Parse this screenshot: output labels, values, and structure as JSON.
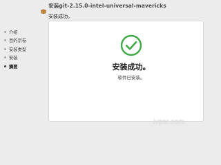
{
  "window": {
    "title": "安装git-2.15.0-intel-universal-mavericks",
    "title_icon": "package-icon",
    "subtitle": "安装成功。"
  },
  "sidebar": {
    "steps": [
      {
        "label": "介绍"
      },
      {
        "label": "目的宗卷"
      },
      {
        "label": "安装类型"
      },
      {
        "label": "安装"
      },
      {
        "label": "摘要"
      }
    ],
    "active_step": "摘要"
  },
  "main": {
    "status_icon": "check-circle-icon",
    "heading": "安装成功。",
    "message": "软件已安装。"
  },
  "watermark": "ivpsr.com",
  "colors": {
    "success_green": "#3fa945",
    "window_bg": "#ececec",
    "panel_bg": "#ffffff"
  }
}
